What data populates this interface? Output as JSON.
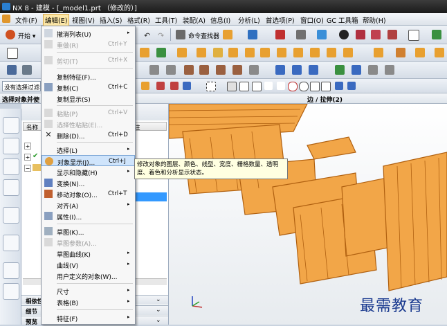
{
  "window": {
    "title": "NX 8 - 建模 - [_model1.prt （修改的）]"
  },
  "menubar": {
    "items": [
      "文件(F)",
      "编辑(E)",
      "视图(V)",
      "插入(S)",
      "格式(R)",
      "工具(T)",
      "装配(A)",
      "信息(I)",
      "分析(L)",
      "首选项(P)",
      "窗口(O)",
      "GC 工具箱",
      "帮助(H)"
    ]
  },
  "toolbar": {
    "start_label": "开始 ▾",
    "cmd_finder": "命令查找器"
  },
  "selbar": {
    "filter": "没有选择过滤器"
  },
  "status": {
    "prompt": "选择对象并使",
    "viewport_caption": "边 / 拉伸(2)"
  },
  "nav": {
    "col_name": "名称",
    "col_other": "注",
    "sections": [
      "相依性",
      "细节",
      "预览"
    ]
  },
  "edit_menu": {
    "items": [
      {
        "label": "撤消列表(U)",
        "shortcut": "",
        "arrow": "▸",
        "disabled": false
      },
      {
        "label": "重做(R)",
        "shortcut": "Ctrl+Y",
        "arrow": "",
        "disabled": true
      },
      {
        "label": "剪切(T)",
        "shortcut": "Ctrl+X",
        "arrow": "",
        "disabled": true
      },
      {
        "label": "复制特征(F)...",
        "shortcut": "",
        "arrow": "",
        "disabled": false
      },
      {
        "label": "复制(C)",
        "shortcut": "Ctrl+C",
        "arrow": "",
        "disabled": false
      },
      {
        "label": "复制显示(S)",
        "shortcut": "",
        "arrow": "",
        "disabled": false
      },
      {
        "label": "粘贴(P)",
        "shortcut": "Ctrl+V",
        "arrow": "",
        "disabled": true
      },
      {
        "label": "选择性粘贴(E)...",
        "shortcut": "",
        "arrow": "",
        "disabled": true
      },
      {
        "label": "删除(D)...",
        "shortcut": "Ctrl+D",
        "arrow": "",
        "disabled": false
      },
      {
        "label": "选择(L)",
        "shortcut": "",
        "arrow": "▸",
        "disabled": false
      },
      {
        "label": "对象显示(J)...",
        "shortcut": "Ctrl+J",
        "arrow": "",
        "disabled": false
      },
      {
        "label": "显示和隐藏(H)",
        "shortcut": "",
        "arrow": "▸",
        "disabled": false
      },
      {
        "label": "变换(N)...",
        "shortcut": "",
        "arrow": "",
        "disabled": false
      },
      {
        "label": "移动对象(O)...",
        "shortcut": "Ctrl+T",
        "arrow": "",
        "disabled": false
      },
      {
        "label": "对齐(A)",
        "shortcut": "",
        "arrow": "▸",
        "disabled": false
      },
      {
        "label": "属性(I)...",
        "shortcut": "",
        "arrow": "",
        "disabled": false
      },
      {
        "label": "草图(K)...",
        "shortcut": "",
        "arrow": "",
        "disabled": false
      },
      {
        "label": "草图参数(A)...",
        "shortcut": "",
        "arrow": "",
        "disabled": true
      },
      {
        "label": "草图曲线(K)",
        "shortcut": "",
        "arrow": "▸",
        "disabled": false
      },
      {
        "label": "曲线(V)",
        "shortcut": "",
        "arrow": "▸",
        "disabled": false
      },
      {
        "label": "用户定义的对象(W)...",
        "shortcut": "",
        "arrow": "",
        "disabled": false
      },
      {
        "label": "尺寸",
        "shortcut": "",
        "arrow": "▸",
        "disabled": false
      },
      {
        "label": "表格(B)",
        "shortcut": "",
        "arrow": "▸",
        "disabled": false
      },
      {
        "label": "特征(F)",
        "shortcut": "",
        "arrow": "▸",
        "disabled": false
      }
    ]
  },
  "tooltip": {
    "line1": "修改对象的图层、颜色、线型、宽度、栅格数量、透明",
    "line2": "度、着色和分析显示状态。"
  },
  "watermark": {
    "text": "最需教育"
  },
  "colors": {
    "accent_orange": "#f0a040",
    "menu_highlight": "#cfe4fb",
    "title_bg": "#2a2a2a"
  }
}
